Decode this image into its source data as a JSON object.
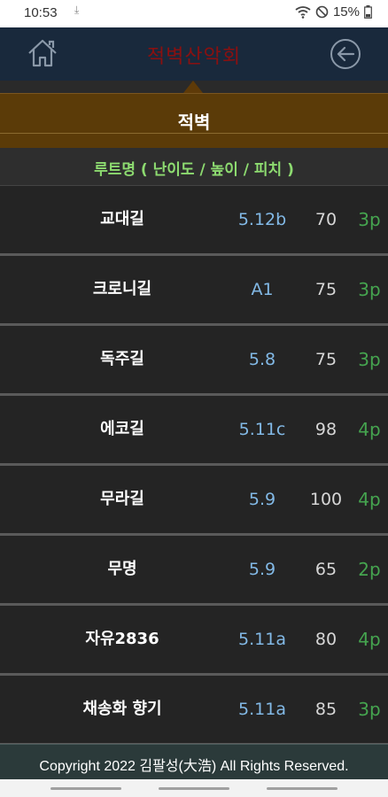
{
  "status_bar": {
    "time": "10:53",
    "battery": "15%"
  },
  "app_bar": {
    "title": "적벽산악회",
    "home_icon": "home-icon",
    "back_icon": "back-arrow-icon"
  },
  "crag": {
    "name": "적벽"
  },
  "list_header": "루트명 ( 난이도 / 높이 / 피치 )",
  "routes": [
    {
      "name": "교대길",
      "grade": "5.12b",
      "height": "70",
      "pitch": "3p"
    },
    {
      "name": "크로니길",
      "grade": "A1",
      "height": "75",
      "pitch": "3p"
    },
    {
      "name": "독주길",
      "grade": "5.8",
      "height": "75",
      "pitch": "3p"
    },
    {
      "name": "에코길",
      "grade": "5.11c",
      "height": "98",
      "pitch": "4p"
    },
    {
      "name": "무라길",
      "grade": "5.9",
      "height": "100",
      "pitch": "4p"
    },
    {
      "name": "무명",
      "grade": "5.9",
      "height": "65",
      "pitch": "2p"
    },
    {
      "name": "자유2836",
      "grade": "5.11a",
      "height": "80",
      "pitch": "4p"
    },
    {
      "name": "채송화 향기",
      "grade": "5.11a",
      "height": "85",
      "pitch": "3p"
    }
  ],
  "footer": "Copyright 2022 김팔성(大浩) All Rights Reserved.",
  "colors": {
    "app_bar": "#19293c",
    "title": "#8a1010",
    "banner": "#5b3b08",
    "header_text": "#8ddb70",
    "grade": "#82b9e6",
    "pitch": "#45a44f"
  }
}
